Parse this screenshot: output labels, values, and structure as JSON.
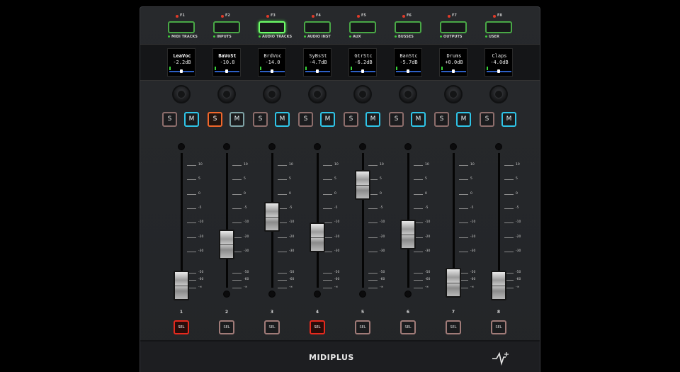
{
  "brand": {
    "name": "MIDIPLUS"
  },
  "function_keys": [
    {
      "num": "F1",
      "label": "MIDI TRACKS",
      "active": false
    },
    {
      "num": "F2",
      "label": "INPUTS",
      "active": false
    },
    {
      "num": "F3",
      "label": "AUDIO TRACKS",
      "active": true
    },
    {
      "num": "F4",
      "label": "AUDIO INST",
      "active": false
    },
    {
      "num": "F5",
      "label": "AUX",
      "active": false
    },
    {
      "num": "F6",
      "label": "BUSSES",
      "active": false
    },
    {
      "num": "F7",
      "label": "OUTPUTS",
      "active": false
    },
    {
      "num": "F8",
      "label": "USER",
      "active": false
    }
  ],
  "channels": [
    {
      "number": "1",
      "name": "LeaVoc",
      "value": "-2.2dB",
      "selected_name": true,
      "pan": 0.5,
      "solo": false,
      "mute": true,
      "mute_dim": false,
      "sel": true,
      "fader_db": -75
    },
    {
      "number": "2",
      "name": "BaVoSt",
      "value": "-10.8",
      "selected_name": true,
      "pan": 0.5,
      "solo": true,
      "mute": true,
      "mute_dim": true,
      "sel": false,
      "fader_db": -25
    },
    {
      "number": "3",
      "name": "BrdVoc",
      "value": "-14.0",
      "selected_name": false,
      "pan": 0.5,
      "solo": false,
      "mute": true,
      "mute_dim": false,
      "sel": false,
      "fader_db": -8
    },
    {
      "number": "4",
      "name": "SyBsSt",
      "value": "-4.7dB",
      "selected_name": false,
      "pan": 0.5,
      "solo": false,
      "mute": true,
      "mute_dim": false,
      "sel": true,
      "fader_db": -20
    },
    {
      "number": "5",
      "name": "GtrStc",
      "value": "-6.2dB",
      "selected_name": false,
      "pan": 0.5,
      "solo": false,
      "mute": true,
      "mute_dim": false,
      "sel": false,
      "fader_db": 3
    },
    {
      "number": "6",
      "name": "BanStc",
      "value": "-5.7dB",
      "selected_name": false,
      "pan": 0.5,
      "solo": false,
      "mute": true,
      "mute_dim": false,
      "sel": false,
      "fader_db": -18
    },
    {
      "number": "7",
      "name": "Drums",
      "value": "+0.0dB",
      "selected_name": false,
      "pan": 0.5,
      "solo": false,
      "mute": true,
      "mute_dim": false,
      "sel": false,
      "fader_db": -68
    },
    {
      "number": "8",
      "name": "Claps",
      "value": "-4.0dB",
      "selected_name": false,
      "pan": 0.5,
      "solo": false,
      "mute": true,
      "mute_dim": false,
      "sel": false,
      "fader_db": -75
    }
  ],
  "fader_scale": [
    "10",
    "5",
    "0",
    "-5",
    "-10",
    "-20",
    "-30",
    "-50",
    "-60",
    "-∞"
  ],
  "buttons": {
    "solo_label": "S",
    "mute_label": "M",
    "select_label": "SEL"
  },
  "colors": {
    "fkey_green": "#49a846",
    "fkey_active": "#6dfd68",
    "solo_on": "#f1672b",
    "mute": "#2fc5e8",
    "sel_on": "#e8291d",
    "led_red": "#e13a28"
  }
}
